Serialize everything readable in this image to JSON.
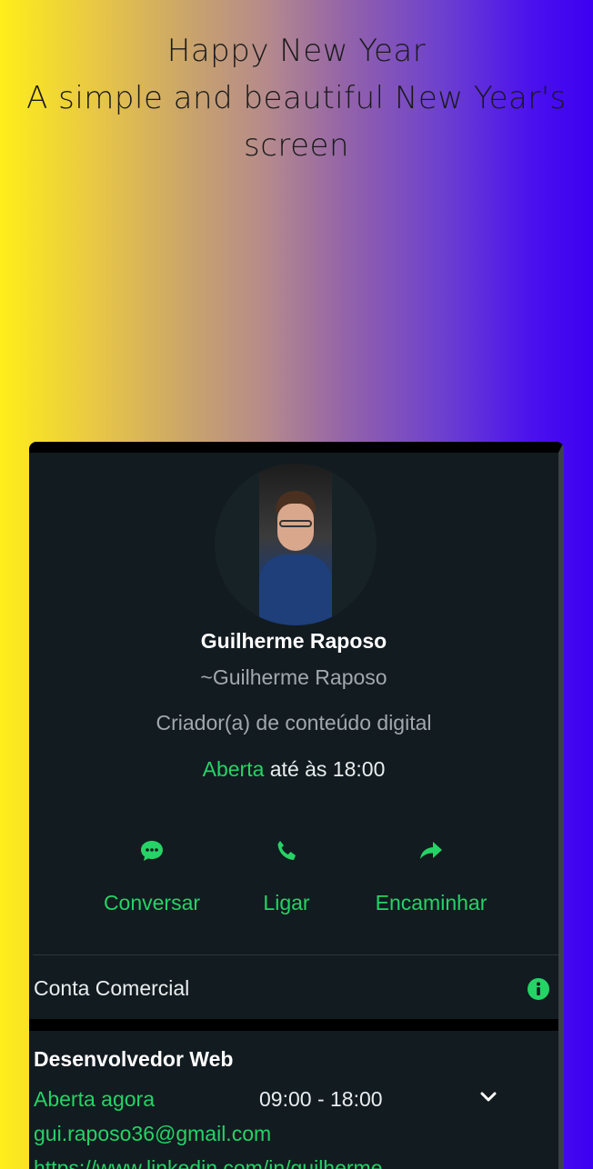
{
  "headline": {
    "line1": "Happy New Year",
    "line2": "A simple and beautiful New Year's",
    "line3": "screen"
  },
  "profile": {
    "name": "Guilherme Raposo",
    "push_name": "~Guilherme Raposo",
    "category": "Criador(a) de conteúdo digital",
    "status_open": "Aberta",
    "status_rest": " até às 18:00"
  },
  "actions": [
    {
      "label": "Conversar",
      "icon": "message-icon"
    },
    {
      "label": "Ligar",
      "icon": "phone-icon"
    },
    {
      "label": "Encaminhar",
      "icon": "forward-icon"
    }
  ],
  "business": {
    "label": "Conta Comercial",
    "icon": "info-icon"
  },
  "details": {
    "title": "Desenvolvedor Web",
    "open_now": "Aberta agora",
    "hours": "09:00 - 18:00",
    "email": "gui.raposo36@gmail.com",
    "url": "https://www.linkedin.com/in/guilherme"
  },
  "colors": {
    "accent": "#25d366",
    "card_bg": "#121b20",
    "text": "#e9edef",
    "muted": "#a2a9ad"
  }
}
